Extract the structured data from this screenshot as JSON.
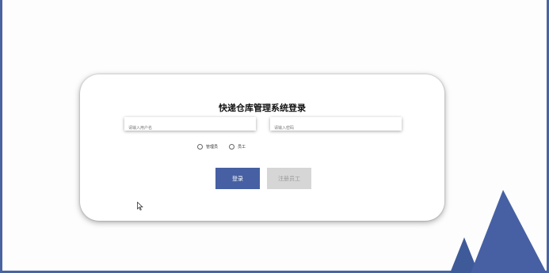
{
  "login": {
    "title": "快递仓库管理系统登录",
    "username_placeholder": "请输入用户名",
    "password_placeholder": "请输入密码",
    "roles": [
      {
        "label": "管理员"
      },
      {
        "label": "员工"
      }
    ],
    "login_button": "登录",
    "register_button": "注册员工"
  },
  "colors": {
    "accent": "#4660a3",
    "frame": "#4a64a2",
    "disabled_button": "#d6d6d6"
  },
  "icons": {
    "cursor": "mouse-pointer-icon"
  }
}
